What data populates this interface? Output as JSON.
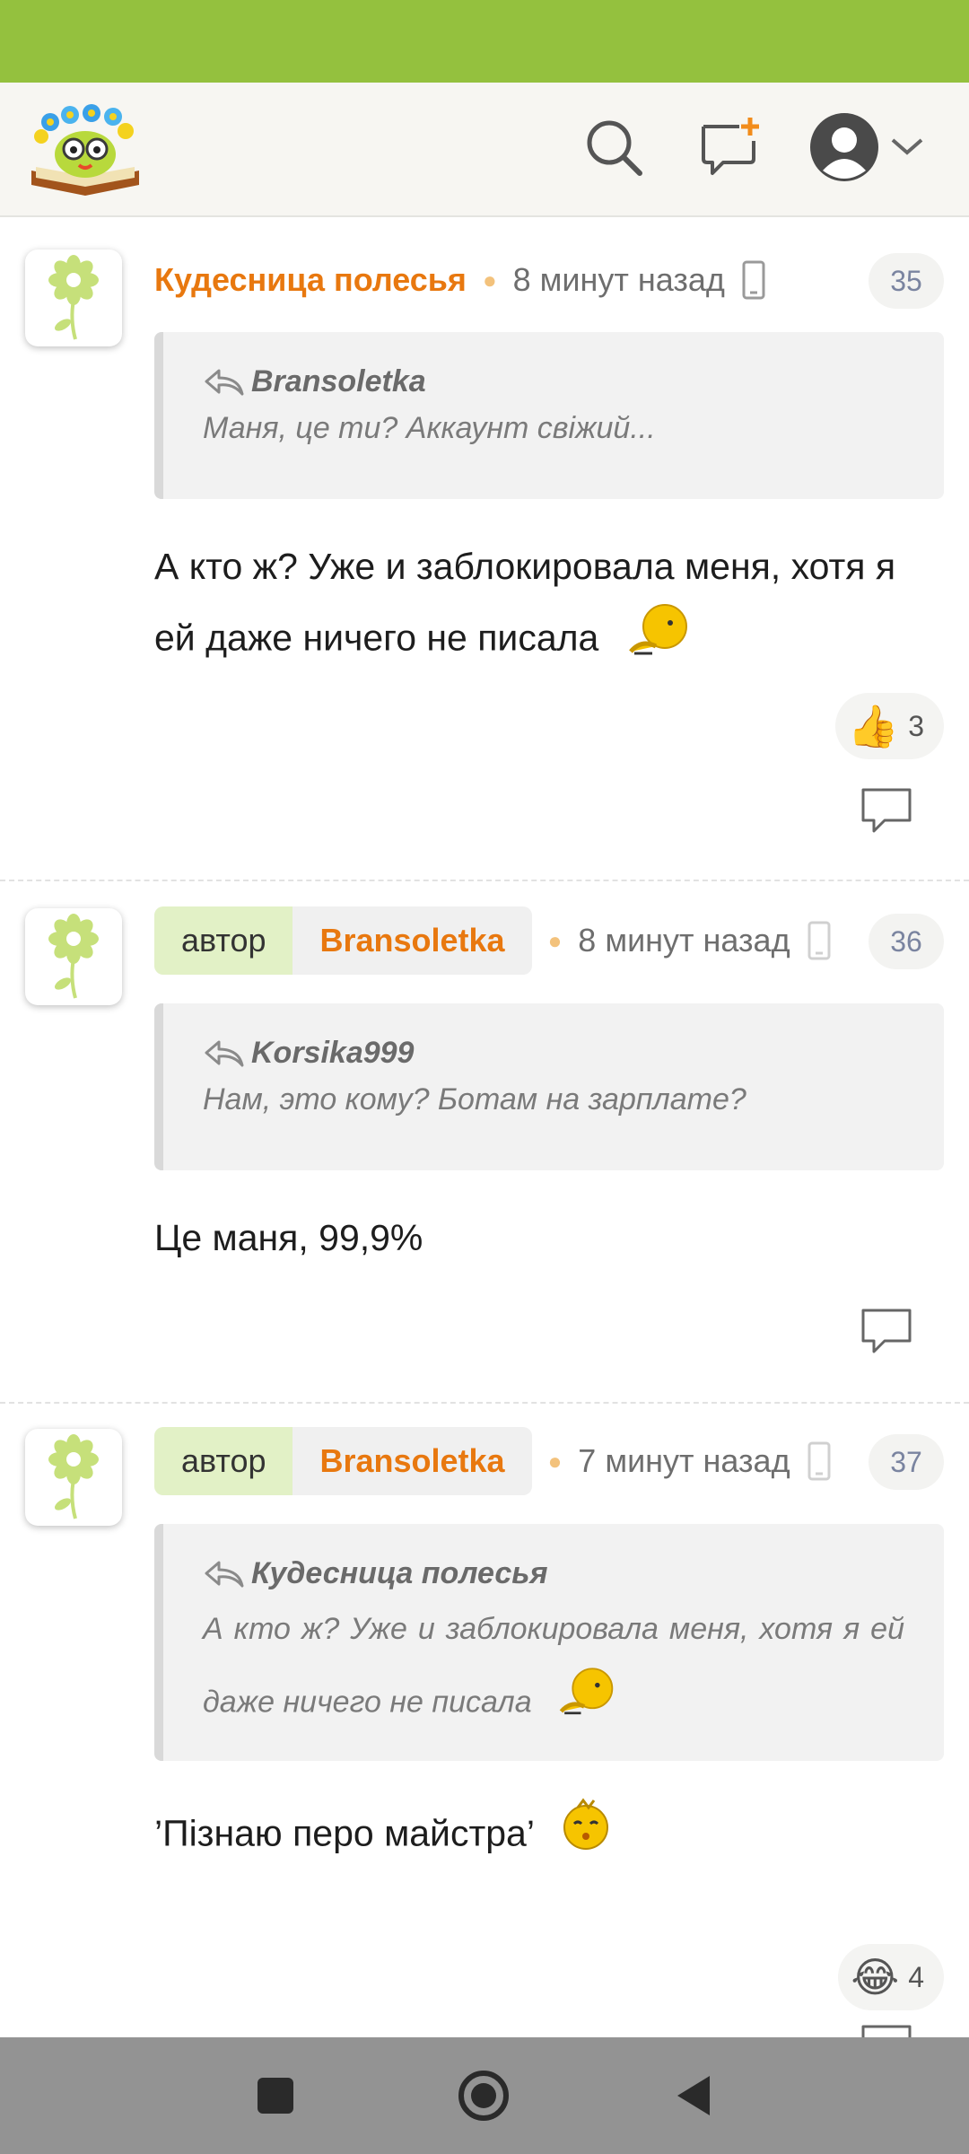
{
  "header": {
    "logo_name": "book-with-flowers-logo",
    "icons": [
      "search-icon",
      "new-post-icon",
      "user-avatar-icon",
      "chevron-down-icon"
    ]
  },
  "comments": [
    {
      "author": "Кудесница полесья",
      "time": "8 минут назад",
      "number": "35",
      "quote_author": "Bransoletka",
      "quote_text": "Маня, це ти? Аккаунт свіжий...",
      "text": "А кто ж? Уже и заблокировала меня, хотя я ей даже ничего не писала",
      "reaction_emoji": "👍",
      "reaction_count": "3"
    },
    {
      "author_tag": "автор",
      "author": "Bransoletka",
      "time": "8 минут назад",
      "number": "36",
      "quote_author": "Korsika999",
      "quote_text": "Нам, это кому? Ботам на зарплате?",
      "text": "Це маня, 99,9%"
    },
    {
      "author_tag": "автор",
      "author": "Bransoletka",
      "time": "7 минут назад",
      "number": "37",
      "quote_author": "Кудесница полесья",
      "quote_text": "А кто ж? Уже и заблокировала меня, хотя я ей даже ничего не писала",
      "text": "’Пізнаю перо майстра’",
      "reaction_emoji": "😂",
      "reaction_count": "4"
    }
  ],
  "colors": {
    "status_bar": "#94c13e",
    "accent_orange": "#e8780f",
    "author_tag_bg": "#e2f1c6",
    "nav_bar": "#939393"
  }
}
